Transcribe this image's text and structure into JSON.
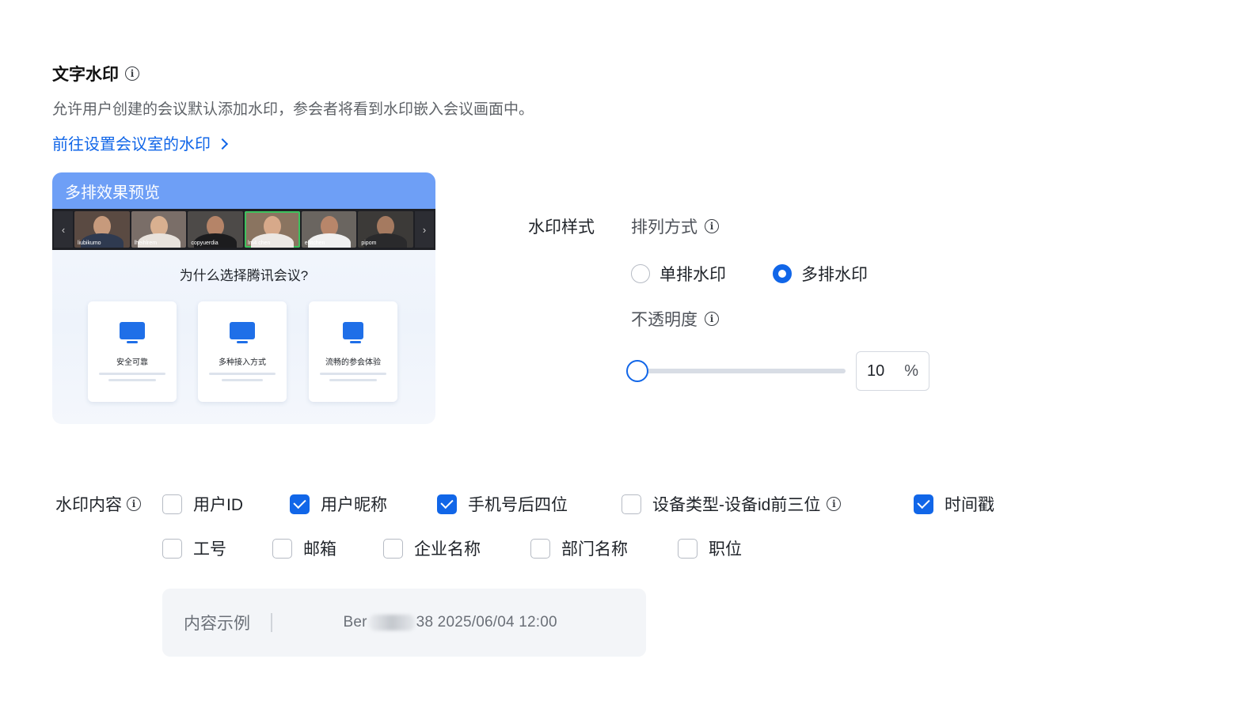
{
  "section": {
    "title": "文字水印",
    "description": "允许用户创建的会议默认添加水印，参会者将看到水印嵌入会议画面中。",
    "link_label": "前往设置会议室的水印"
  },
  "preview": {
    "header": "多排效果预览",
    "question": "为什么选择腾讯会议?",
    "participants": [
      "liubikumo",
      "lheihlrem",
      "copyuerdia",
      "lm4 chen",
      "ellitchen",
      "pipom"
    ],
    "features": [
      {
        "title": "安全可靠"
      },
      {
        "title": "多种接入方式"
      },
      {
        "title": "流畅的参会体验"
      }
    ]
  },
  "style": {
    "label": "水印样式",
    "arrange_label": "排列方式",
    "options": [
      {
        "label": "单排水印",
        "selected": false
      },
      {
        "label": "多排水印",
        "selected": true
      }
    ],
    "opacity_label": "不透明度",
    "opacity_value": "10",
    "opacity_unit": "%",
    "opacity_fraction": 0.1
  },
  "content": {
    "label": "水印内容",
    "options": [
      {
        "label": "用户ID",
        "checked": false
      },
      {
        "label": "用户昵称",
        "checked": true
      },
      {
        "label": "手机号后四位",
        "checked": true
      },
      {
        "label": "设备类型-设备id前三位",
        "checked": false
      },
      {
        "label": "时间戳",
        "checked": true
      },
      {
        "label": "工号",
        "checked": false
      },
      {
        "label": "邮箱",
        "checked": false
      },
      {
        "label": "企业名称",
        "checked": false
      },
      {
        "label": "部门名称",
        "checked": false
      },
      {
        "label": "职位",
        "checked": false
      }
    ],
    "example_label": "内容示例",
    "example_prefix": "Ber",
    "example_suffix": "38 2025/06/04 12:00"
  },
  "colors": {
    "accent": "#1166e8",
    "preview_header": "#6e9ff6"
  }
}
